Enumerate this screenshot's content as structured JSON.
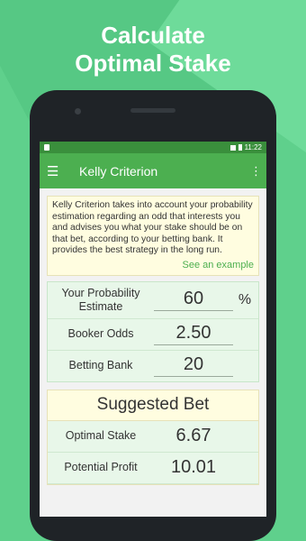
{
  "headline": {
    "line1": "Calculate",
    "line2": "Optimal Stake"
  },
  "statusbar": {
    "time": "11:22"
  },
  "appbar": {
    "title": "Kelly Criterion",
    "menu_icon": "☰",
    "overflow_icon": "⋮"
  },
  "info": {
    "text": "Kelly Criterion takes into account your probability estimation regarding an odd that interests you and advises you what your stake should be on that bet, according to your betting bank. It provides the best strategy in the long run.",
    "link": "See an example"
  },
  "inputs": {
    "probability": {
      "label": "Your Probability Estimate",
      "value": "60",
      "unit": "%"
    },
    "odds": {
      "label": "Booker Odds",
      "value": "2.50"
    },
    "bank": {
      "label": "Betting Bank",
      "value": "20"
    }
  },
  "result": {
    "title": "Suggested Bet",
    "stake": {
      "label": "Optimal Stake",
      "value": "6.67"
    },
    "profit": {
      "label": "Potential Profit",
      "value": "10.01"
    }
  }
}
